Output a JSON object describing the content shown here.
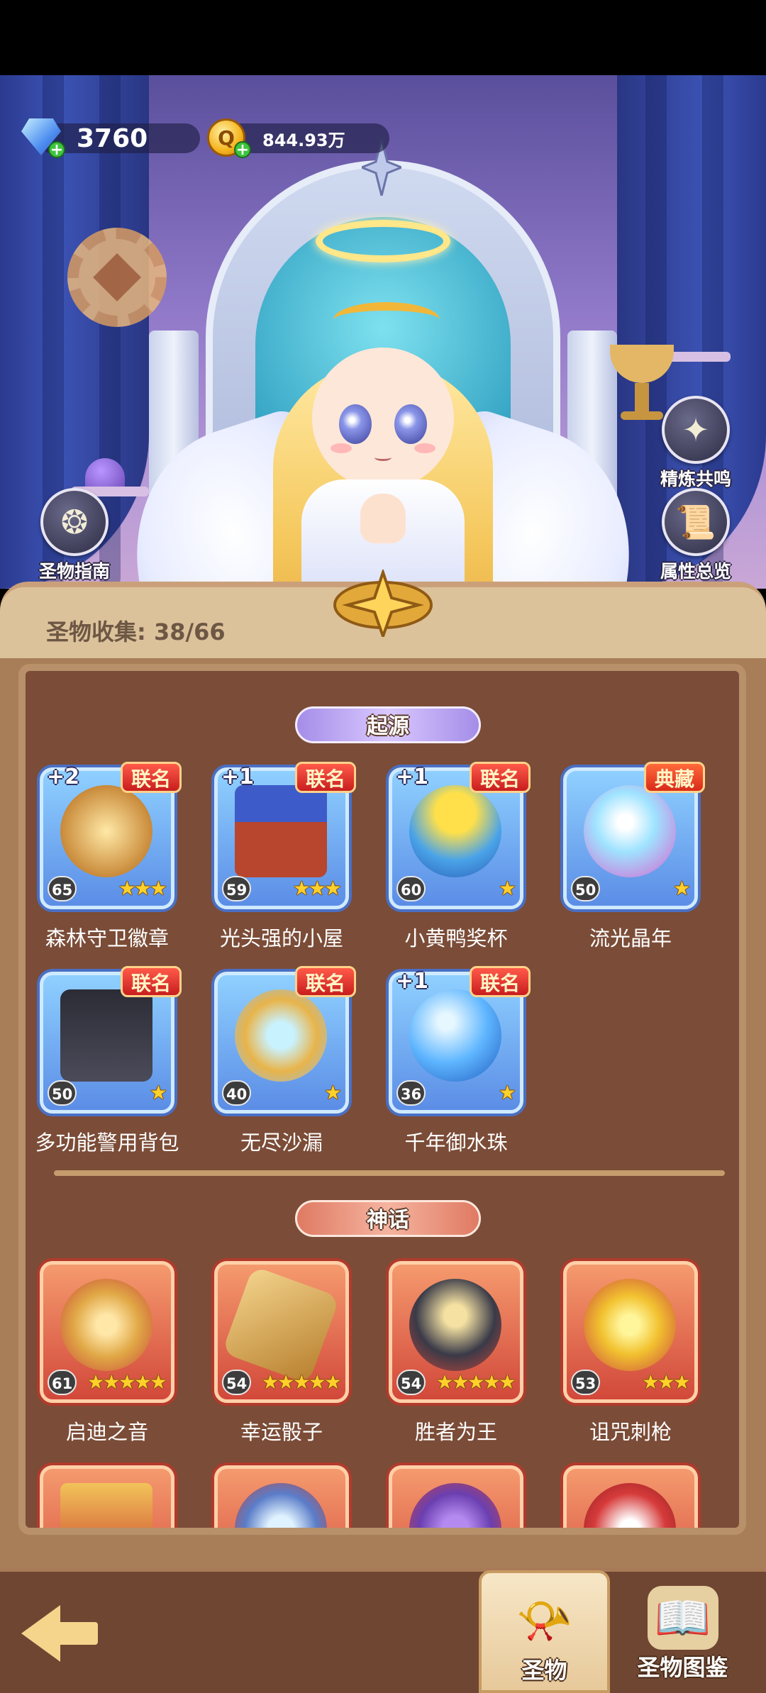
{
  "currency": {
    "diamonds": "3760",
    "coins": "844.93万",
    "diamond_icon": "diamond-icon",
    "coin_icon": "coin-icon"
  },
  "side_buttons": {
    "refine_resonance": "精炼共鸣",
    "attribute_overview": "属性总览",
    "relic_guide": "圣物指南"
  },
  "panel": {
    "collection_label": "圣物收集: 38/66"
  },
  "sections": [
    {
      "title": "起源",
      "items": [
        {
          "name": "森林守卫徽章",
          "level": "65",
          "stars": "★★★",
          "badge": "联名",
          "plus": "+2"
        },
        {
          "name": "光头强的小屋",
          "level": "59",
          "stars": "★★★",
          "badge": "联名",
          "plus": "+1"
        },
        {
          "name": "小黄鸭奖杯",
          "level": "60",
          "stars": "★",
          "badge": "联名",
          "plus": "+1"
        },
        {
          "name": "流光晶年",
          "level": "50",
          "stars": "★",
          "badge": "典藏",
          "plus": ""
        },
        {
          "name": "多功能警用背包",
          "level": "50",
          "stars": "★",
          "badge": "联名",
          "plus": ""
        },
        {
          "name": "无尽沙漏",
          "level": "40",
          "stars": "★",
          "badge": "联名",
          "plus": ""
        },
        {
          "name": "千年御水珠",
          "level": "36",
          "stars": "★",
          "badge": "联名",
          "plus": "+1"
        }
      ]
    },
    {
      "title": "神话",
      "items": [
        {
          "name": "启迪之音",
          "level": "61",
          "stars": "★★★★★",
          "badge": "",
          "plus": ""
        },
        {
          "name": "幸运骰子",
          "level": "54",
          "stars": "★★★★★",
          "badge": "",
          "plus": ""
        },
        {
          "name": "胜者为王",
          "level": "54",
          "stars": "★★★★★",
          "badge": "",
          "plus": ""
        },
        {
          "name": "诅咒刺枪",
          "level": "53",
          "stars": "★★★",
          "badge": "",
          "plus": ""
        }
      ]
    }
  ],
  "bottom_nav": {
    "tab_relic": "圣物",
    "tab_codex": "圣物图鉴"
  },
  "colors": {
    "origin_frame": "#5b8de6",
    "myth_frame": "#d2483a",
    "panel_brown": "#7b4c37",
    "badge_red": "#c81e1e"
  }
}
